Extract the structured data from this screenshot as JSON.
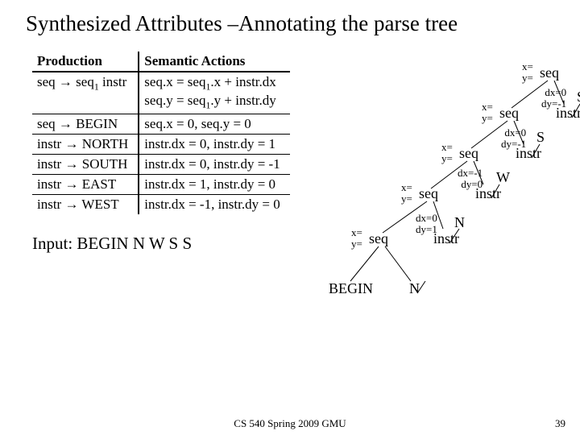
{
  "title": "Synthesized Attributes –Annotating the parse tree",
  "table": {
    "head_prod": "Production",
    "head_act": "Semantic Actions",
    "rows": [
      {
        "p": "seq → seq₁ instr",
        "a": "seq.x = seq₁.x + instr.dx\nseq.y = seq₁.y + instr.dy"
      },
      {
        "p": "seq → BEGIN",
        "a": "seq.x = 0,  seq.y = 0"
      },
      {
        "p": "instr → NORTH",
        "a": "instr.dx = 0, instr.dy = 1"
      },
      {
        "p": "instr → SOUTH",
        "a": "instr.dx = 0, instr.dy = -1"
      },
      {
        "p": "instr → EAST",
        "a": "instr.dx = 1, instr.dy = 0"
      },
      {
        "p": "instr → WEST",
        "a": "instr.dx = -1, instr.dy = 0"
      }
    ]
  },
  "input_label": "Input:  BEGIN N W S S",
  "tree": {
    "n1": "seq",
    "n2": "seq",
    "i2": "instr",
    "t2": "S",
    "n3": "seq",
    "i3": "instr",
    "t3": "S",
    "n4": "seq",
    "i4": "instr",
    "t4": "W",
    "n5": "seq",
    "i5": "instr",
    "t5": "N",
    "begin": "BEGIN"
  },
  "ann": {
    "xy": "x=\ny=",
    "d2": "dx=0\ndy=-1",
    "d3": "dx=0\ndy=-1",
    "d4": "dx=-1\ndy=0",
    "d5": "dx=0\ndy=1"
  },
  "footer": "CS 540 Spring 2009 GMU",
  "page": "39"
}
